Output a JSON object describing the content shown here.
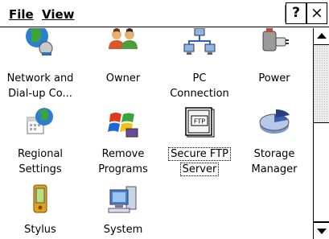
{
  "menubar": {
    "file_label": "File",
    "view_label": "View",
    "help_label": "?",
    "close_label": "×"
  },
  "items": [
    {
      "line1": "Network and",
      "line2": "Dial-up Co...",
      "icon": "network-globe-icon"
    },
    {
      "line1": "Owner",
      "line2": "",
      "icon": "owner-people-icon"
    },
    {
      "line1": "PC",
      "line2": "Connection",
      "icon": "pc-connection-icon"
    },
    {
      "line1": "Power",
      "line2": "",
      "icon": "power-plug-icon"
    },
    {
      "line1": "Regional",
      "line2": "Settings",
      "icon": "regional-settings-icon"
    },
    {
      "line1": "Remove",
      "line2": "Programs",
      "icon": "remove-programs-icon"
    },
    {
      "line1": "Secure FTP",
      "line2": "Server",
      "icon": "ftp-server-icon",
      "selected": true
    },
    {
      "line1": "Storage",
      "line2": "Manager",
      "icon": "storage-pie-icon"
    },
    {
      "line1": "Stylus",
      "line2": "",
      "icon": "stylus-device-icon"
    },
    {
      "line1": "System",
      "line2": "",
      "icon": "system-computer-icon"
    }
  ],
  "ftp_icon_text": "FTP"
}
